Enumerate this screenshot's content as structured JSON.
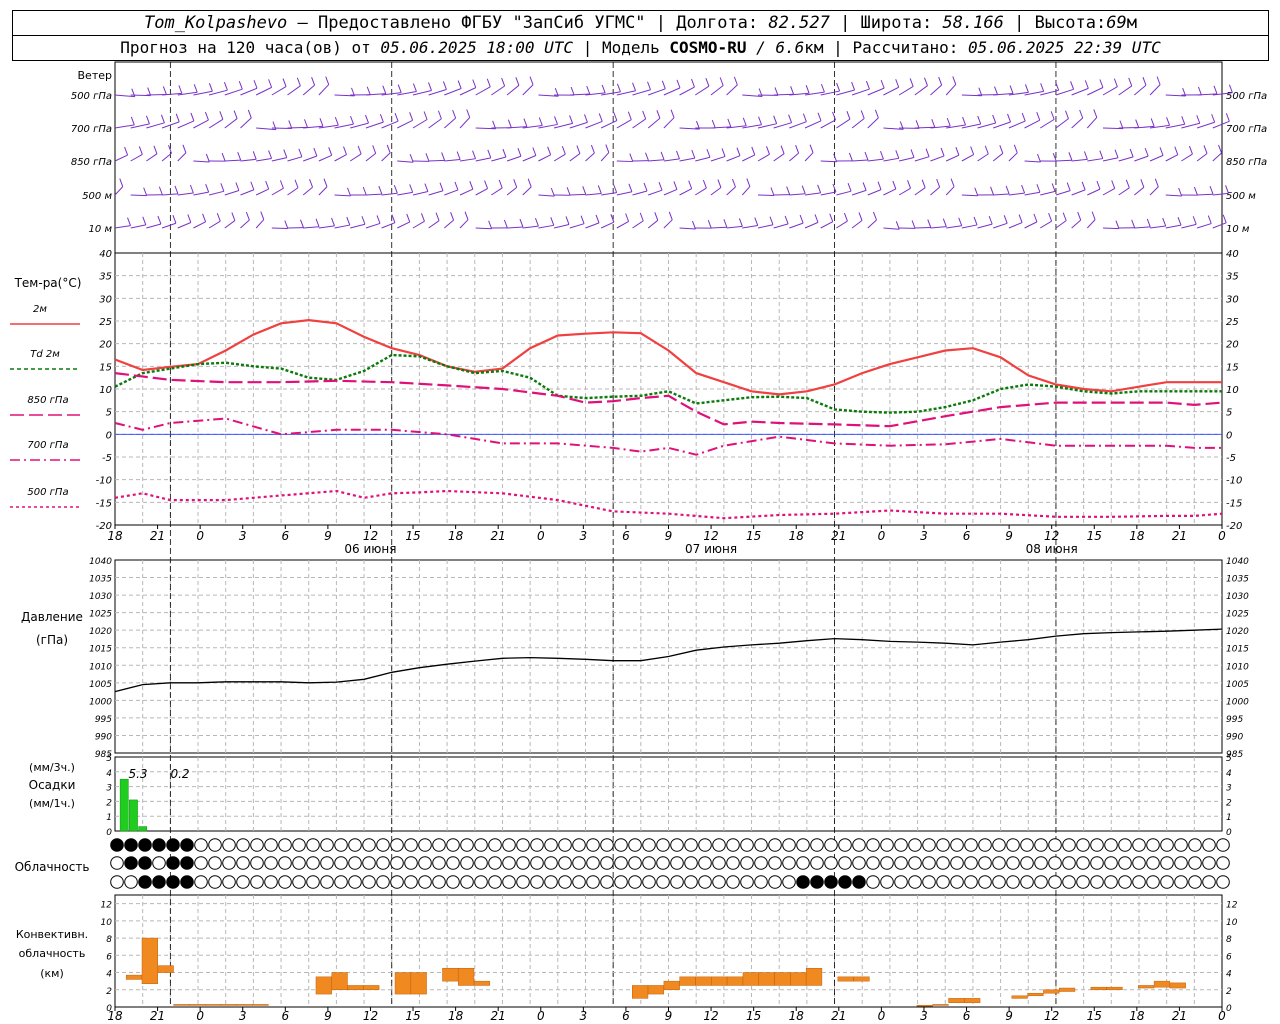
{
  "header": {
    "station": "Tom_Kolpashevo",
    "provider": "— Предоставлено ФГБУ \"ЗапСиб УГМС\" |",
    "lon_label": "Долгота:",
    "lon": "82.527",
    "lat_label": "| Широта:",
    "lat": "58.166",
    "alt_label": "| Высота:",
    "alt": "69",
    "alt_unit": "м",
    "fc_label": "Прогноз на 120 часа(ов) от",
    "fc_from": "05.06.2025 18:00 UTC",
    "model_label": "| Модель",
    "model": "COSMO-RU",
    "res": "/ 6.6",
    "res_unit": "км",
    "calc_label": "| Рассчитано:",
    "calc": "05.06.2025 22:39 UTC"
  },
  "time_axis": {
    "hour_labels": [
      "18",
      "21",
      "0",
      "3",
      "6",
      "9",
      "12",
      "15",
      "18",
      "21",
      "0",
      "3",
      "6",
      "9",
      "12",
      "15",
      "18",
      "21",
      "0",
      "3",
      "6",
      "9",
      "12",
      "15",
      "18",
      "21",
      "0"
    ],
    "date_labels": [
      "06 июня",
      "07 июня",
      "08 июня"
    ]
  },
  "wind": {
    "title": "Ветер",
    "levels": [
      "500 гПа",
      "700 гПа",
      "850 гПа",
      "500 м",
      "10  м"
    ]
  },
  "temperature": {
    "title": "Тем-ра(°C)",
    "legend": [
      {
        "label": "2м",
        "color": "#f04040",
        "dash": ""
      },
      {
        "label": "Td  2м",
        "color": "#0a7a0a",
        "dash": "4,3"
      },
      {
        "label": "850 гПа",
        "color": "#e0107a",
        "dash": "14,5"
      },
      {
        "label": "700 гПа",
        "color": "#e0107a",
        "dash": "10,4,2,4"
      },
      {
        "label": "500 гПа",
        "color": "#e0107a",
        "dash": "3,3"
      }
    ]
  },
  "pressure": {
    "title": "Давление",
    "unit": "(гПа)"
  },
  "precip": {
    "label1": "(мм/3ч.)",
    "label2": "Осадки",
    "label3": "(мм/1ч.)",
    "annotations": [
      "5.3",
      "0.2"
    ],
    "bar_color": "#20cc20"
  },
  "cloudiness": {
    "title": "Облачность"
  },
  "convective": {
    "label1": "Конвективн.",
    "label2": "облачность",
    "label3": "(км)",
    "bar_color": "#f08a20"
  },
  "chart_data": [
    {
      "type": "line",
      "title": "Тем-ра(°C)",
      "x_unit": "hours from 05.06 18:00 UTC",
      "ylim": [
        -20,
        40
      ],
      "series": [
        {
          "name": "2м",
          "x": [
            0,
            3,
            6,
            9,
            12,
            15,
            18,
            21,
            24,
            27,
            30,
            33,
            36,
            39,
            42,
            45,
            48,
            51,
            54,
            57,
            60,
            63,
            66,
            69,
            72,
            75,
            78,
            81,
            84,
            87,
            90,
            93,
            96,
            99,
            102,
            105,
            108,
            111,
            114,
            117,
            120
          ],
          "values": [
            16.5,
            14.2,
            14.9,
            15.5,
            18.5,
            22,
            24.5,
            25.2,
            24.5,
            21.5,
            19,
            17.5,
            15,
            13.8,
            14.5,
            19,
            21.8,
            22.2,
            22.5,
            22.3,
            18.5,
            13.5,
            11.5,
            9.5,
            8.8,
            9.5,
            11,
            13.5,
            15.5,
            17,
            18.5,
            19,
            17,
            13,
            11,
            10,
            9.5,
            10.5,
            11.5,
            11.5,
            11.5
          ]
        },
        {
          "name": "Td  2м",
          "x": [
            0,
            3,
            6,
            9,
            12,
            15,
            18,
            21,
            24,
            27,
            30,
            33,
            36,
            39,
            42,
            45,
            48,
            51,
            54,
            57,
            60,
            63,
            66,
            69,
            72,
            75,
            78,
            81,
            84,
            87,
            90,
            93,
            96,
            99,
            102,
            105,
            108,
            111,
            114,
            117,
            120
          ],
          "values": [
            10.5,
            13.5,
            14.5,
            15.5,
            15.8,
            15,
            14.5,
            12.5,
            12,
            14,
            17.5,
            17.2,
            15,
            13.5,
            14,
            12.5,
            8.5,
            8,
            8.3,
            8.5,
            9.5,
            6.8,
            7.5,
            8.2,
            8.3,
            8,
            5.5,
            5,
            4.8,
            5,
            6,
            7.5,
            10,
            11,
            10.5,
            9.5,
            9,
            9.5,
            9.5,
            9.5,
            9.5
          ]
        },
        {
          "name": "850 гПа",
          "x": [
            0,
            6,
            12,
            18,
            24,
            30,
            36,
            42,
            48,
            51,
            54,
            57,
            60,
            63,
            66,
            69,
            72,
            78,
            84,
            90,
            96,
            102,
            108,
            114,
            117,
            120
          ],
          "values": [
            13.5,
            12,
            11.5,
            11.5,
            11.8,
            11.5,
            10.8,
            10,
            8.5,
            7,
            7.3,
            8,
            8.5,
            5,
            2.2,
            2.8,
            2.5,
            2.2,
            1.8,
            4,
            6,
            7,
            7,
            7,
            6.5,
            7
          ]
        },
        {
          "name": "700 гПа",
          "x": [
            0,
            3,
            6,
            12,
            18,
            24,
            30,
            36,
            42,
            48,
            54,
            57,
            60,
            63,
            66,
            72,
            78,
            84,
            90,
            96,
            102,
            108,
            114,
            117,
            120
          ],
          "values": [
            2.5,
            1,
            2.5,
            3.5,
            0,
            1,
            1,
            0,
            -2,
            -2,
            -3,
            -3.8,
            -3,
            -4.5,
            -2.5,
            -0.5,
            -2,
            -2.5,
            -2.2,
            -1,
            -2.5,
            -2.5,
            -2.5,
            -3,
            -3
          ]
        },
        {
          "name": "500 гПа",
          "x": [
            0,
            3,
            6,
            12,
            18,
            24,
            27,
            30,
            33,
            36,
            42,
            48,
            54,
            60,
            66,
            72,
            78,
            84,
            90,
            96,
            102,
            108,
            114,
            117,
            120
          ],
          "values": [
            -14,
            -13,
            -14.5,
            -14.5,
            -13.5,
            -12.5,
            -14,
            -13,
            -12.8,
            -12.5,
            -13,
            -14.5,
            -17,
            -17.5,
            -18.5,
            -17.8,
            -17.5,
            -16.8,
            -17.5,
            -17.5,
            -18.2,
            -18.2,
            -18,
            -18,
            -17.5
          ]
        }
      ]
    },
    {
      "type": "line",
      "title": "Давление",
      "ylabel": "(гПа)",
      "ylim": [
        985,
        1040
      ],
      "series": [
        {
          "x": [
            0,
            3,
            6,
            9,
            12,
            15,
            18,
            21,
            24,
            27,
            30,
            33,
            36,
            39,
            42,
            45,
            48,
            51,
            54,
            57,
            60,
            63,
            66,
            69,
            72,
            75,
            78,
            81,
            84,
            87,
            90,
            93,
            96,
            99,
            102,
            105,
            108,
            111,
            114,
            117,
            120
          ],
          "values": [
            1002.5,
            1004.5,
            1005,
            1005,
            1005.3,
            1005.3,
            1005.3,
            1005,
            1005.2,
            1006,
            1008,
            1009.3,
            1010.3,
            1011.2,
            1012,
            1012.2,
            1012,
            1011.7,
            1011.3,
            1011.3,
            1012.5,
            1014.3,
            1015.2,
            1015.8,
            1016.3,
            1017,
            1017.6,
            1017.3,
            1016.8,
            1016.6,
            1016.3,
            1015.8,
            1016.6,
            1017.3,
            1018.3,
            1019,
            1019.3,
            1019.5,
            1019.7,
            1020,
            1020.3
          ]
        }
      ]
    },
    {
      "type": "bar",
      "title": "Осадки",
      "ylim": [
        0,
        5
      ],
      "x": [
        1,
        2,
        3,
        4
      ],
      "values": [
        3.5,
        2.1,
        0.3,
        0
      ]
    },
    {
      "type": "bar",
      "title": "Конвективн. облачность (км)",
      "ylim": [
        0,
        13
      ],
      "bars": [
        {
          "x": 1,
          "bottom": 3.2,
          "top": 3.7
        },
        {
          "x": 2,
          "bottom": 2.7,
          "top": 8
        },
        {
          "x": 3,
          "bottom": 4,
          "top": 4.8
        },
        {
          "x": 4,
          "bottom": 0.2,
          "top": 0.3
        },
        {
          "x": 5,
          "bottom": 0.2,
          "top": 0.3
        },
        {
          "x": 6,
          "bottom": 0.2,
          "top": 0.3
        },
        {
          "x": 7,
          "bottom": 0.2,
          "top": 0.3
        },
        {
          "x": 8,
          "bottom": 0.2,
          "top": 0.3
        },
        {
          "x": 9,
          "bottom": 0.2,
          "top": 0.3
        },
        {
          "x": 13,
          "bottom": 1.5,
          "top": 3.5
        },
        {
          "x": 14,
          "bottom": 2,
          "top": 4
        },
        {
          "x": 15,
          "bottom": 2,
          "top": 2.5
        },
        {
          "x": 16,
          "bottom": 2,
          "top": 2.5
        },
        {
          "x": 18,
          "bottom": 1.5,
          "top": 4
        },
        {
          "x": 19,
          "bottom": 1.5,
          "top": 4
        },
        {
          "x": 21,
          "bottom": 3,
          "top": 4.5
        },
        {
          "x": 22,
          "bottom": 2.5,
          "top": 4.5
        },
        {
          "x": 23,
          "bottom": 2.5,
          "top": 3
        },
        {
          "x": 33,
          "bottom": 1,
          "top": 2.5
        },
        {
          "x": 34,
          "bottom": 1.5,
          "top": 2.5
        },
        {
          "x": 35,
          "bottom": 2,
          "top": 3
        },
        {
          "x": 36,
          "bottom": 2.5,
          "top": 3.5
        },
        {
          "x": 37,
          "bottom": 2.5,
          "top": 3.5
        },
        {
          "x": 38,
          "bottom": 2.5,
          "top": 3.5
        },
        {
          "x": 39,
          "bottom": 2.5,
          "top": 3.5
        },
        {
          "x": 40,
          "bottom": 2.5,
          "top": 4
        },
        {
          "x": 41,
          "bottom": 2.5,
          "top": 4
        },
        {
          "x": 42,
          "bottom": 2.5,
          "top": 4
        },
        {
          "x": 43,
          "bottom": 2.5,
          "top": 4
        },
        {
          "x": 44,
          "bottom": 2.5,
          "top": 4.5
        },
        {
          "x": 46,
          "bottom": 3,
          "top": 3.5
        },
        {
          "x": 47,
          "bottom": 3,
          "top": 3.5
        },
        {
          "x": 51,
          "bottom": 0.1,
          "top": 0.2
        },
        {
          "x": 52,
          "bottom": 0.2,
          "top": 0.3
        },
        {
          "x": 53,
          "bottom": 0.5,
          "top": 1
        },
        {
          "x": 54,
          "bottom": 0.5,
          "top": 1
        },
        {
          "x": 57,
          "bottom": 1,
          "top": 1.3
        },
        {
          "x": 58,
          "bottom": 1.3,
          "top": 1.6
        },
        {
          "x": 59,
          "bottom": 1.6,
          "top": 2
        },
        {
          "x": 60,
          "bottom": 1.8,
          "top": 2.2
        },
        {
          "x": 62,
          "bottom": 2,
          "top": 2.3
        },
        {
          "x": 63,
          "bottom": 2,
          "top": 2.3
        },
        {
          "x": 65,
          "bottom": 2.2,
          "top": 2.5
        },
        {
          "x": 66,
          "bottom": 2.3,
          "top": 3
        },
        {
          "x": 67,
          "bottom": 2.2,
          "top": 2.8
        }
      ]
    }
  ]
}
